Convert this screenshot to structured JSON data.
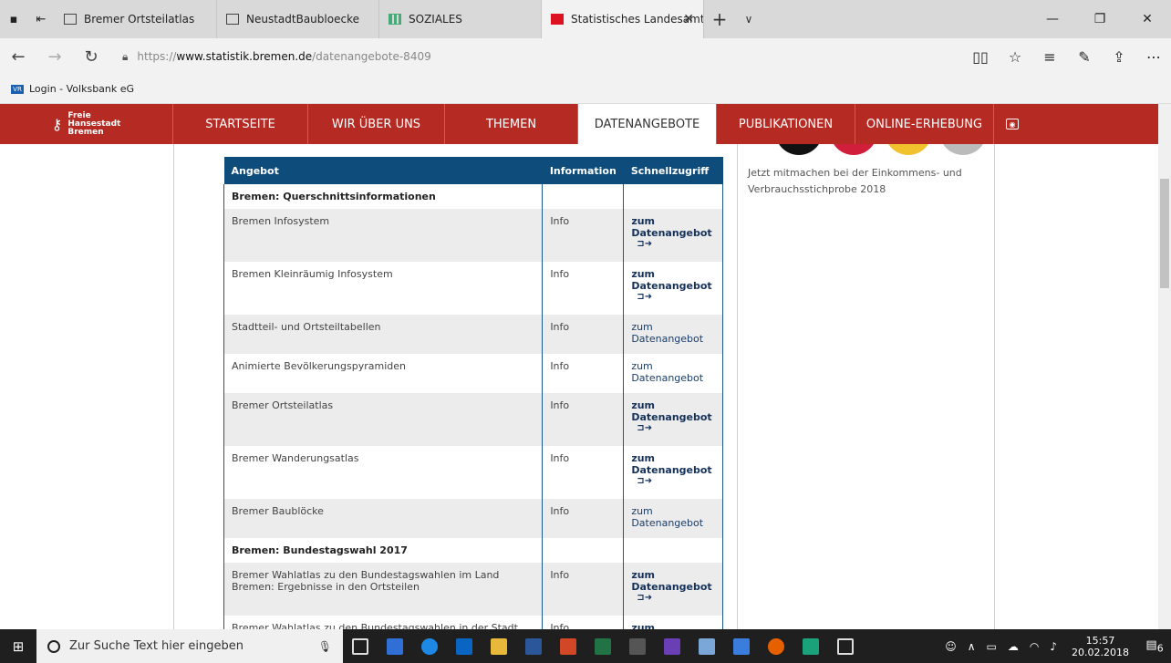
{
  "browser": {
    "tabs": [
      {
        "label": "Bremer Ortsteilatlas",
        "icon": "page-icon"
      },
      {
        "label": "NeustadtBaubloecke",
        "icon": "page-icon"
      },
      {
        "label": "SOZIALES",
        "icon": "spreadsheet-icon"
      },
      {
        "label": "Statistisches Landesamt",
        "icon": "bremen-favicon",
        "active": true
      }
    ],
    "url_scheme": "https://",
    "url_host": "www.statistik.bremen.de",
    "url_path": "/datenangebote-8409",
    "favorite": "Login - Volksbank eG"
  },
  "site": {
    "logo_lines": [
      "Freie",
      "Hansestadt",
      "Bremen"
    ],
    "nav": [
      "STARTSEITE",
      "WIR ÜBER UNS",
      "THEMEN",
      "DATENANGEBOTE",
      "PUBLIKATIONEN",
      "ONLINE-ERHEBUNG"
    ],
    "active_nav": "DATENANGEBOTE",
    "side_text": "Jetzt mitmachen bei der Einkommens- und Verbrauchsstichprobe 2018"
  },
  "table": {
    "headers": [
      "Angebot",
      "Information",
      "Schnellzugriff"
    ],
    "rows": [
      {
        "type": "section",
        "name": "Bremen: Querschnittsinformationen"
      },
      {
        "name": "Bremen Infosystem",
        "info": "Info",
        "qa": "zum Datenangebot",
        "strong": true
      },
      {
        "name": "Bremen Kleinräumig Infosystem",
        "info": "Info",
        "qa": "zum Datenangebot",
        "strong": true
      },
      {
        "name": "Stadtteil- und Ortsteiltabellen",
        "info": "Info",
        "qa": "zum Datenangebot",
        "strong": false
      },
      {
        "name": "Animierte Bevölkerungspyramiden",
        "info": "Info",
        "qa": "zum Datenangebot",
        "strong": false
      },
      {
        "name": "Bremer Ortsteilatlas",
        "info": "Info",
        "qa": "zum Datenangebot",
        "strong": true
      },
      {
        "name": "Bremer Wanderungsatlas",
        "info": "Info",
        "qa": "zum Datenangebot",
        "strong": true
      },
      {
        "name": "Bremer Baublöcke",
        "info": "Info",
        "qa": "zum Datenangebot",
        "strong": false
      },
      {
        "type": "section",
        "name": "Bremen: Bundestagswahl 2017"
      },
      {
        "name": "Bremer Wahlatlas zu den Bundestagswahlen im Land Bremen: Ergebnisse in den Ortsteilen",
        "info": "Info",
        "qa": "zum Datenangebot",
        "strong": true
      },
      {
        "name": "Bremer Wahlatlas zu den Bundestagswahlen in der Stadt Bremen:",
        "info": "Info",
        "qa": "zum",
        "strong": true
      }
    ]
  },
  "taskbar": {
    "search_placeholder": "Zur Suche Text hier eingeben",
    "time": "15:57",
    "date": "20.02.2018",
    "notifications": "6"
  },
  "colors": {
    "nav_red": "#b52a23",
    "table_header": "#0e4c7c"
  }
}
